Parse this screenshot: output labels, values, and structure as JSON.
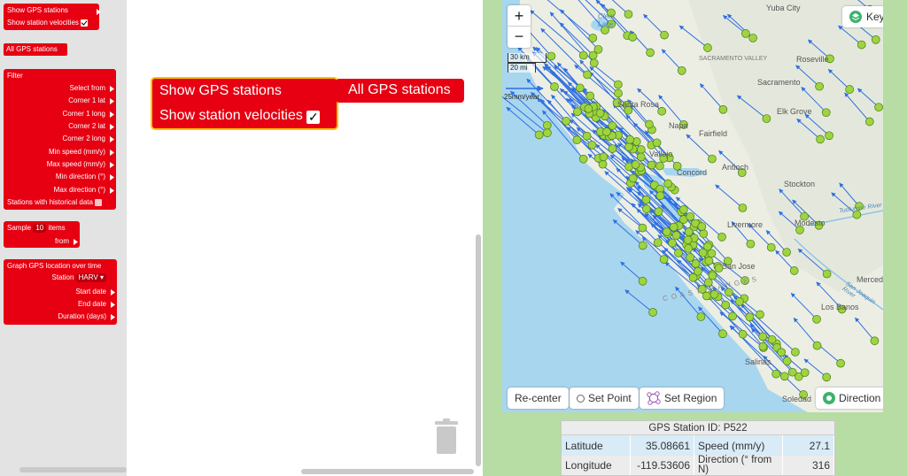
{
  "toolbox": {
    "show_gps_stations": "Show GPS stations",
    "show_station_velocities": "Show station velocities",
    "all_gps_stations": "All GPS stations",
    "filter": {
      "title": "Filter",
      "rows": [
        "Select from",
        "Corner 1 lat",
        "Corner 1 long",
        "Corner 2 lat",
        "Corner 2 long",
        "Min speed (mm/y)",
        "Max speed (mm/y)",
        "Min direction (°)",
        "Max direction (°)",
        "Stations with historical data"
      ]
    },
    "sample": {
      "label": "Sample",
      "count": "10",
      "items": "items",
      "from": "from"
    },
    "graph": {
      "title": "Graph GPS location over time",
      "station_label": "Station",
      "station_value": "HARV",
      "rows": [
        "Start date",
        "End date",
        "Duration (days)"
      ]
    }
  },
  "workspace": {
    "show_gps_stations": "Show GPS stations",
    "show_station_velocities": "Show station velocities",
    "all_gps_stations": "All GPS stations"
  },
  "map": {
    "zoom_in": "+",
    "zoom_out": "−",
    "scale_km": "30 km",
    "scale_mi": "20 mi",
    "velocity_scale": "25mm/year",
    "key_label": "Key",
    "places": [
      "Yuba City",
      "Clear Lake",
      "SACRAMENTO VALLEY",
      "Roseville",
      "Sacramento",
      "Santa Rosa",
      "Napa",
      "Fairfield",
      "Elk Grove",
      "Vallejo",
      "Concord",
      "Antioch",
      "Stockton",
      "Modesto",
      "Livermore",
      "San Jose",
      "Merced",
      "Los Banos",
      "Salinas",
      "Soledad",
      "Tuolumne River",
      "San Joaquin River",
      "C O A S T   R A N G E S"
    ],
    "buttons": {
      "recenter": "Re-center",
      "set_point": "Set Point",
      "set_region": "Set Region",
      "direction": "Direction"
    },
    "colors": {
      "station": "#9ed43f",
      "arrow": "#2f6fe0",
      "water": "#a9d6ef",
      "land": "#eceee4"
    }
  },
  "station_info": {
    "title": "GPS Station ID: P522",
    "latitude_label": "Latitude",
    "latitude_value": "35.08661",
    "speed_label": "Speed (mm/y)",
    "speed_value": "27.1",
    "longitude_label": "Longitude",
    "longitude_value": "-119.53606",
    "direction_label": "Direction (° from N)",
    "direction_value": "316"
  },
  "colors": {
    "block_red": "#e60012",
    "block_outline": "#f5c400",
    "flyout_bg": "#e3e3e3"
  }
}
